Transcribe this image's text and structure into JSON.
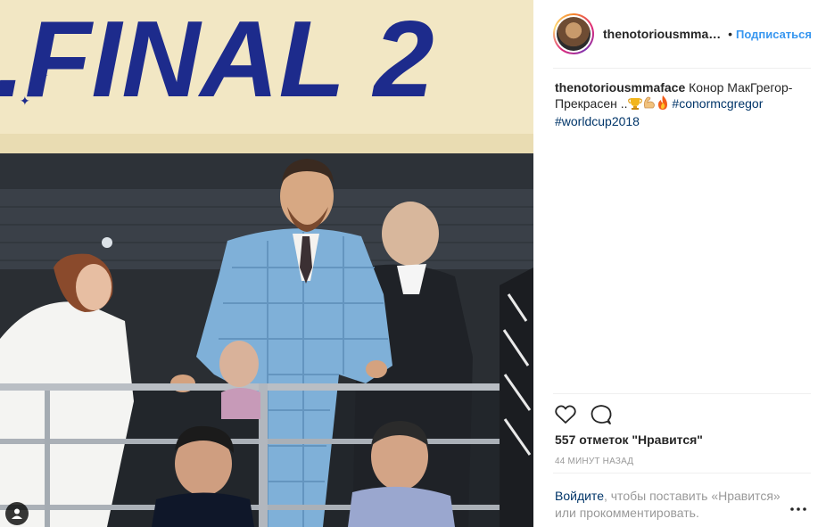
{
  "post": {
    "author": "thenotoriousmmafa...",
    "separator": "•",
    "follow_label": "Подписаться",
    "caption": {
      "author": "thenotoriousmmaface",
      "text": "Конор МакГрегор- Прекрасен ..",
      "emojis": [
        "trophy-icon",
        "flexed-biceps-icon",
        "fire-icon"
      ],
      "hashtags": [
        "#conormcgregor",
        "#worldcup2018"
      ]
    },
    "likes_text": "557 отметок \"Нравится\"",
    "time_text": "44 МИНУТ НАЗАД",
    "login_link": "Войдите",
    "login_rest_1": ", чтобы поставить «Нравится»",
    "login_rest_2": "или прокомментировать."
  },
  "photo": {
    "banner_text": ".FINAL 2",
    "colors": {
      "banner": "#f2e7c4",
      "banner_text": "#1d2b8c",
      "suit": "#7fb0d8",
      "dark": "#1c1f24"
    }
  },
  "colors": {
    "accent": "#3897f0",
    "link": "#003569",
    "muted": "#999999",
    "text": "#262626"
  }
}
